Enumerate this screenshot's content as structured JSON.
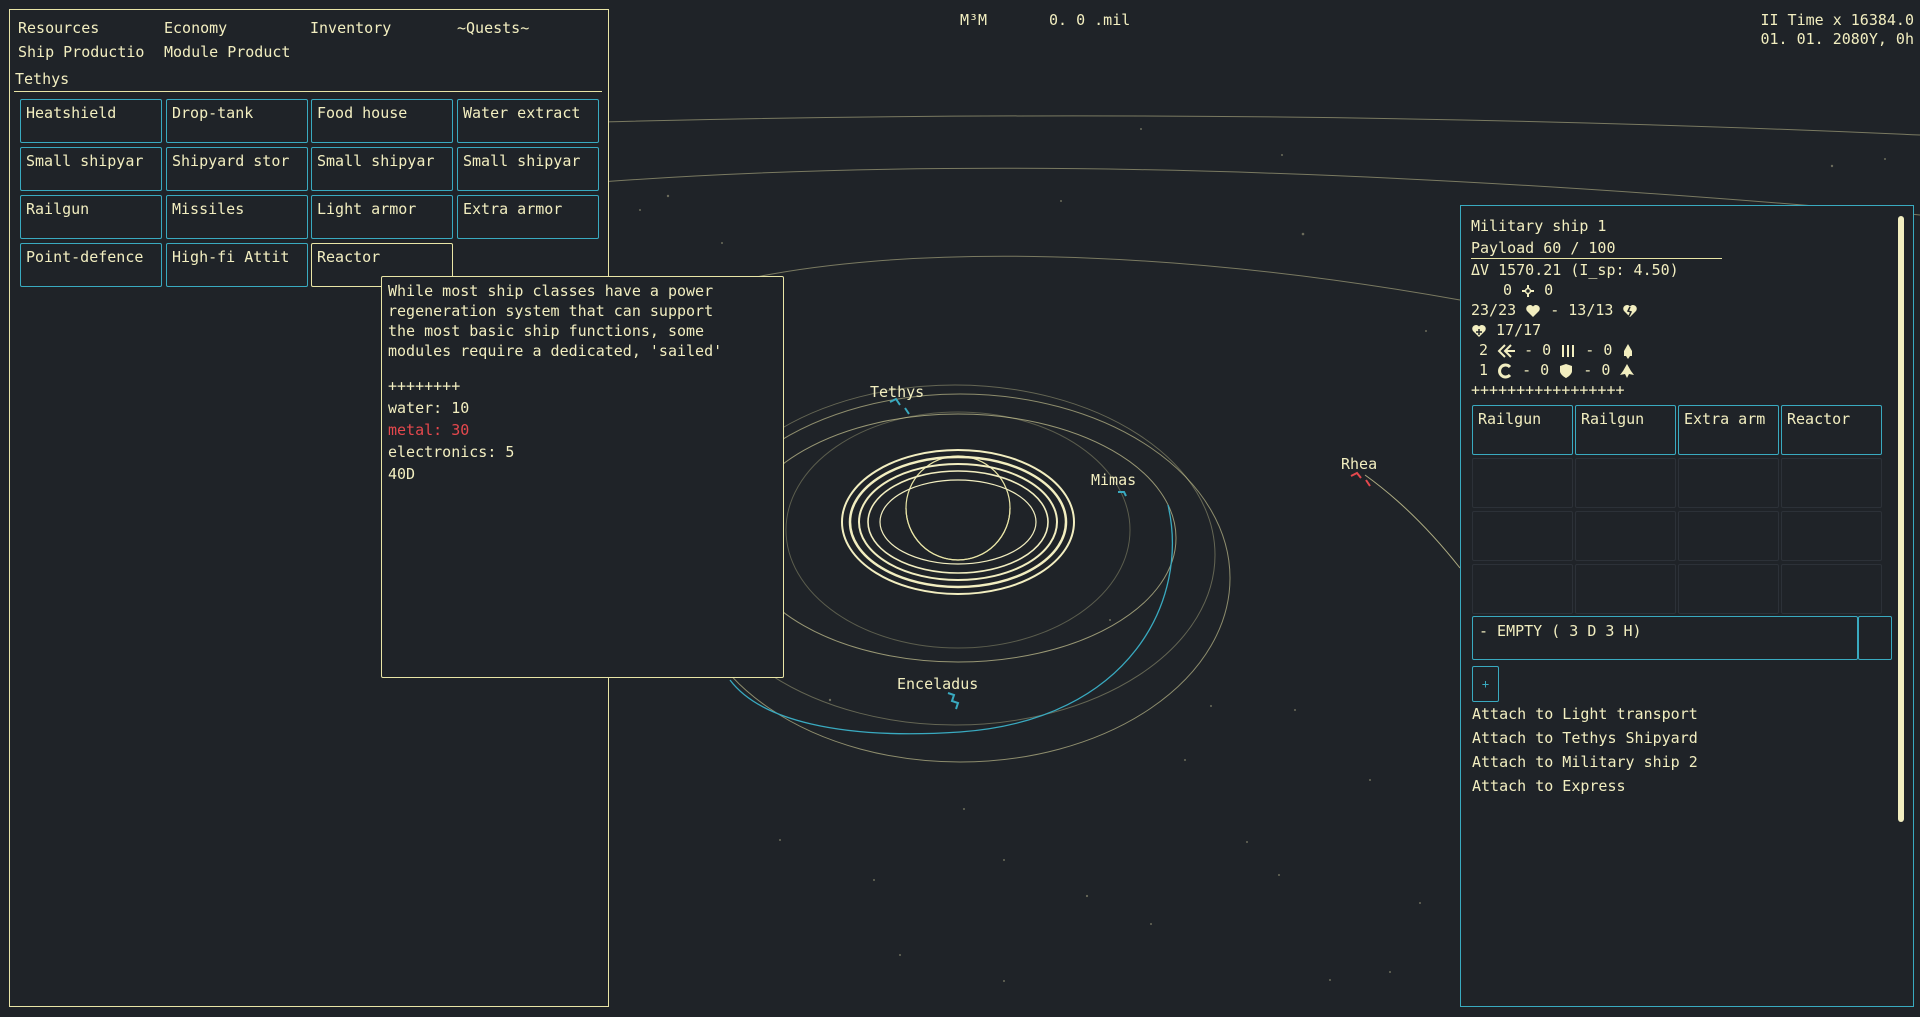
{
  "top_bar": {
    "currency": "M³M",
    "mil_value": "0.  0 .mil",
    "time_label": "II Time x 16384.0",
    "date_label": "01. 01. 2080Y,  0h"
  },
  "left_panel": {
    "menu": [
      "Resources",
      "Economy",
      "Inventory",
      "~Quests~"
    ],
    "tabs": [
      "Ship Productio",
      "Module Product"
    ],
    "location": "Tethys",
    "modules": [
      "Heatshield",
      "Drop-tank",
      "Food house",
      "Water extract",
      "Small shipyar",
      "Shipyard stor",
      "Small shipyar",
      "Small shipyar",
      "Railgun",
      "Missiles",
      "Light armor",
      "Extra armor",
      "Point-defence",
      "High-fi Attit",
      "Reactor"
    ]
  },
  "tooltip": {
    "description": [
      "While most ship classes have a power",
      "regeneration system that can support",
      "the most basic ship functions, some",
      "modules require a dedicated, 'sailed'"
    ],
    "separator": "++++++++",
    "costs": [
      {
        "text": "water: 10",
        "status": "ok"
      },
      {
        "text": "metal: 30",
        "status": "insufficient"
      },
      {
        "text": "electronics: 5",
        "status": "ok"
      },
      {
        "text": "40D",
        "status": "ok"
      }
    ]
  },
  "map": {
    "bodies": [
      "Tethys",
      "Mimas",
      "Rhea",
      "Enceladus"
    ]
  },
  "ship_panel": {
    "name": "Military ship 1",
    "payload": "Payload 60 / 100",
    "delta_v": "ΔV 1570.21 (I_sp: 4.50)",
    "crew_row": {
      "left": "0",
      "right": "0"
    },
    "hp_row": {
      "hull": "23/23",
      "sep": "-",
      "armor": "13/13"
    },
    "shield": "17/17",
    "weapons_row1": {
      "a": "2",
      "b": "0",
      "c": "0",
      "sep": "-"
    },
    "weapons_row2": {
      "a": "1",
      "b": "0",
      "c": "0",
      "sep": "-"
    },
    "separator": "+++++++++++++++++",
    "slots": [
      "Railgun",
      "Railgun",
      "Extra arm",
      "Reactor",
      "",
      "",
      "",
      "",
      "",
      "",
      "",
      "",
      "",
      "",
      "",
      ""
    ],
    "schedule": "- EMPTY (  3 D  3 H)",
    "add_label": "+",
    "attach": [
      "Attach to Light transport",
      "Attach to Tethys Shipyard",
      "Attach to Military ship 2",
      "Attach to Express"
    ]
  },
  "colors": {
    "background": "#1f2328",
    "text": "#f2eec0",
    "accent_border": "#39aac0",
    "warn": "#e5484d",
    "enemy_marker": "#e5484d"
  }
}
